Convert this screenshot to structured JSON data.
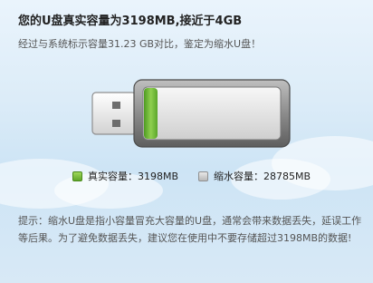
{
  "header": {
    "title": "您的U盘真实容量为3198MB,接近于4GB",
    "subtitle": "经过与系统标示容量31.23 GB对比，鉴定为缩水U盘！"
  },
  "legend": {
    "real_label": "真实容量：3198MB",
    "fake_label": "缩水容量：28785MB",
    "real_color": "#6ab533",
    "fake_color": "#c4c4c4"
  },
  "gauge": {
    "real_mb": 3198,
    "fake_mb": 28785,
    "real_fraction": 0.1
  },
  "tip": {
    "text": "提示：缩水U盘是指小容量冒充大容量的U盘，通常会带来数据丢失，延误工作等后果。为了避免数据丢失，建议您在使用中不要存储超过3198MB的数据!"
  }
}
